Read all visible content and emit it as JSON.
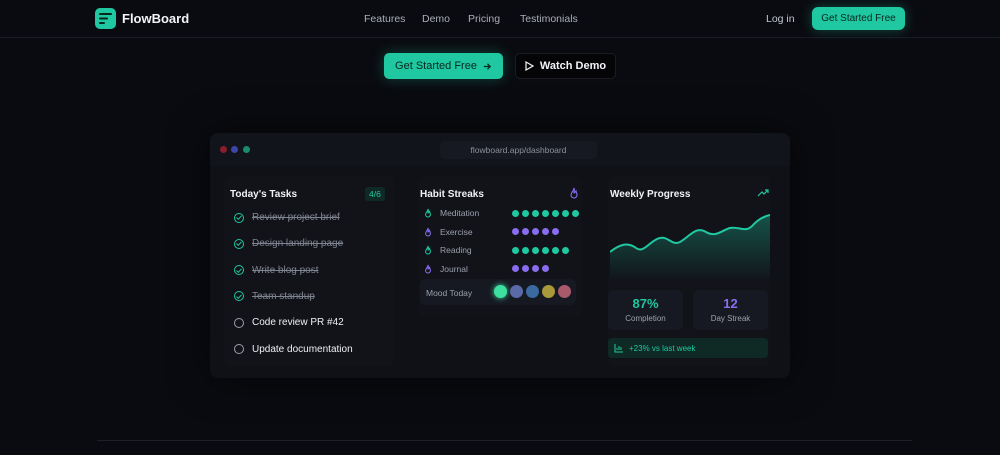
{
  "nav": {
    "brand": "FlowBoard",
    "links": [
      "Features",
      "Demo",
      "Pricing",
      "Testimonials"
    ],
    "login": "Log in",
    "cta": "Get Started Free"
  },
  "hero": {
    "primary_cta": "Get Started Free",
    "secondary_cta": "Watch Demo"
  },
  "window": {
    "url": "flowboard.app/dashboard",
    "dot_colors": [
      "#8b1d2c",
      "#3d46a8",
      "#1a8c6a"
    ]
  },
  "tasks": {
    "title": "Today's Tasks",
    "badge": "4/6",
    "items": [
      {
        "label": "Review project brief",
        "done": true
      },
      {
        "label": "Design landing page",
        "done": true
      },
      {
        "label": "Write blog post",
        "done": true
      },
      {
        "label": "Team standup",
        "done": true
      },
      {
        "label": "Code review PR #42",
        "done": false
      },
      {
        "label": "Update documentation",
        "done": false
      }
    ]
  },
  "habits": {
    "title": "Habit Streaks",
    "items": [
      {
        "name": "Meditation",
        "count": 7,
        "color": "#1fc8a1"
      },
      {
        "name": "Exercise",
        "count": 5,
        "color": "#8a6cf0"
      },
      {
        "name": "Reading",
        "count": 6,
        "color": "#1fc8a1"
      },
      {
        "name": "Journal",
        "count": 4,
        "color": "#8a6cf0"
      }
    ],
    "mood_label": "Mood Today",
    "mood_colors": [
      "#3ee0a0",
      "#5a6aa8",
      "#3a6aa0",
      "#a89a3a",
      "#a85a6a"
    ]
  },
  "progress": {
    "title": "Weekly Progress",
    "completion_value": "87%",
    "completion_label": "Completion",
    "streak_value": "12",
    "streak_label": "Day Streak",
    "trend": "+23% vs last week",
    "accent": "#1fc8a1",
    "secondary_accent": "#8a6cf0"
  }
}
